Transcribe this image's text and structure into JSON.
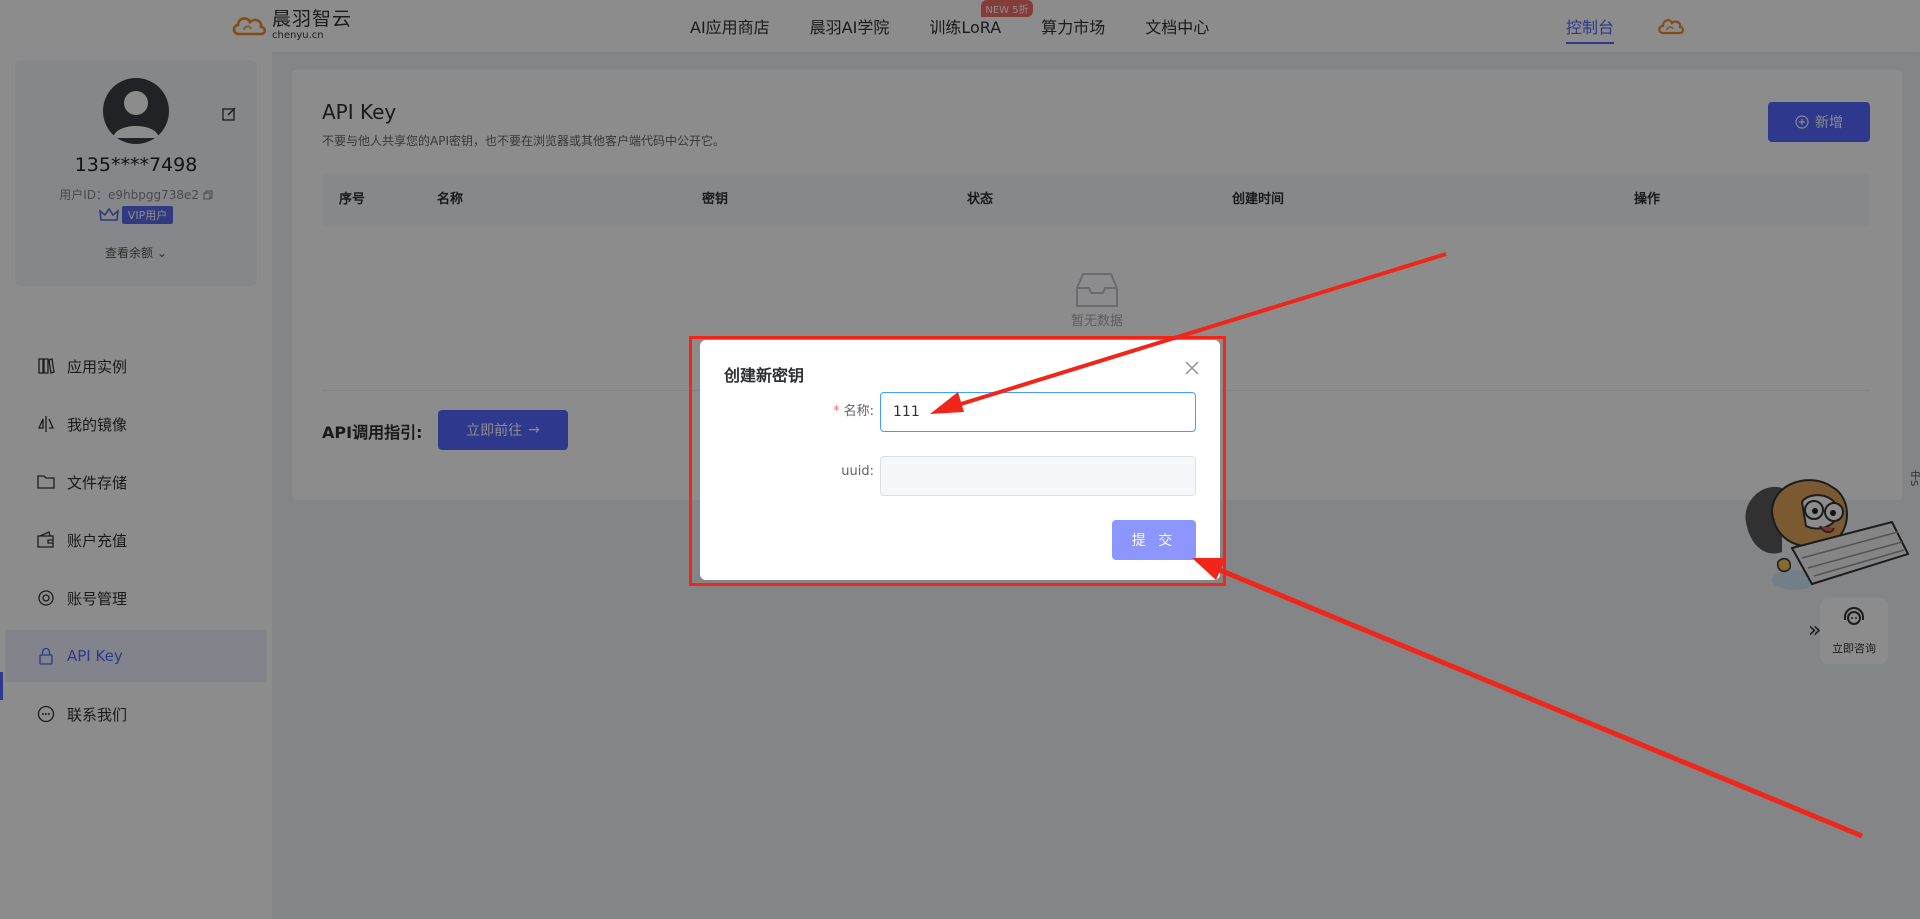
{
  "nav": {
    "logo_name": "晨羽智云",
    "logo_sub": "chenyu.cn",
    "links": [
      "AI应用商店",
      "晨羽AI学院",
      "训练LoRA",
      "算力市场",
      "文档中心"
    ],
    "badge": "NEW 5折",
    "console": "控制台"
  },
  "profile": {
    "phone": "135****7498",
    "user_id": "用户ID：e9hbpgg738e2",
    "vip": "VIP用户",
    "balance": "查看余额"
  },
  "menu": [
    {
      "label": "应用实例",
      "icon": "book-icon"
    },
    {
      "label": "我的镜像",
      "icon": "mirror-icon"
    },
    {
      "label": "文件存储",
      "icon": "folder-icon"
    },
    {
      "label": "账户充值",
      "icon": "wallet-icon"
    },
    {
      "label": "账号管理",
      "icon": "gear-icon"
    },
    {
      "label": "API Key",
      "icon": "lock-icon"
    },
    {
      "label": "联系我们",
      "icon": "chat-icon"
    }
  ],
  "main": {
    "title": "API Key",
    "description": "不要与他人共享您的API密钥，也不要在浏览器或其他客户端代码中公开它。",
    "new_button": "新增",
    "columns": [
      "序号",
      "名称",
      "密钥",
      "状态",
      "创建时间",
      "操作"
    ],
    "empty_text": "暂无数据",
    "guide_label": "API调用指引:",
    "guide_button": "立即前往"
  },
  "dialog": {
    "title": "创建新密钥",
    "name_label": "名称:",
    "name_value": "111",
    "uuid_label": "uuid:",
    "uuid_value": "",
    "submit": "提 交"
  },
  "widget": {
    "consult": "立即咨询",
    "side_text": "中S"
  },
  "colors": {
    "accent": "#5567ff",
    "annotation": "#f0261b"
  }
}
